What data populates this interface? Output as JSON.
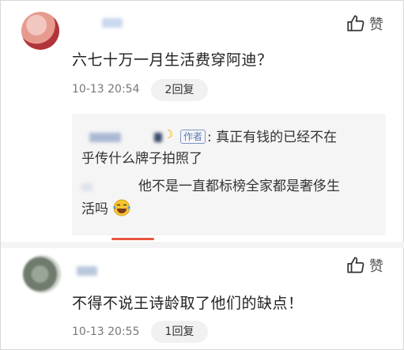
{
  "comments": [
    {
      "text": "六七十万一月生活费穿阿迪？",
      "time": "10-13 20:54",
      "reply_label": "2回复",
      "like_label": "赞"
    },
    {
      "text": "不得不说王诗龄取了他们的缺点！",
      "time": "10-13 20:55",
      "reply_label": "1回复",
      "like_label": "赞"
    }
  ],
  "replies": [
    {
      "author_tag": "作者",
      "line1": ": 真正有钱的已经不在",
      "line2": "乎传什么牌子拍照了"
    },
    {
      "line1": "他不是一直都标榜全家都是奢侈生",
      "line2": "活吗"
    }
  ],
  "colors": {
    "accent_red": "#e8563f",
    "author_tag": "#5b7ab8",
    "reply_bg": "#f5f5f5"
  },
  "icons": [
    "thumbs-up-icon",
    "laughing-crying-emoji-icon",
    "moon-emoji-icon"
  ]
}
